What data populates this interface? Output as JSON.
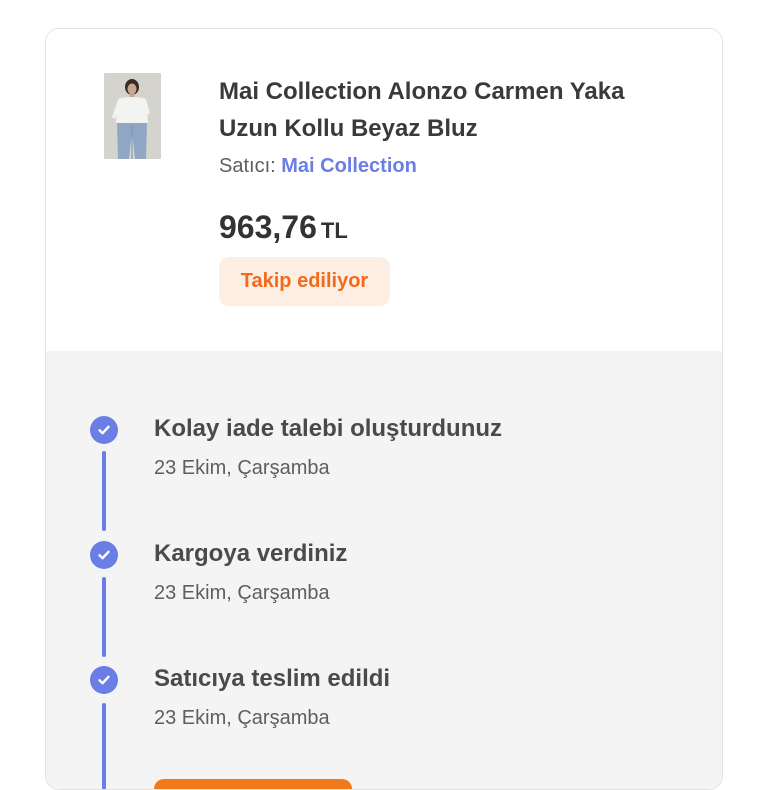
{
  "product": {
    "image_alt": "product-photo",
    "title": "Mai Collection Alonzo Carmen Yaka Uzun Kollu Beyaz Bluz",
    "seller_label": "Satıcı:",
    "seller_name": "Mai Collection",
    "price_amount": "963,76",
    "price_currency": "TL",
    "status": "Takip ediliyor"
  },
  "timeline": {
    "steps": [
      {
        "title": "Kolay iade talebi oluşturdunuz",
        "date": "23 Ekim, Çarşamba",
        "icon": "check-circle-icon"
      },
      {
        "title": "Kargoya verdiniz",
        "date": "23 Ekim, Çarşamba",
        "icon": "check-circle-icon"
      },
      {
        "title": "Satıcıya teslim edildi",
        "date": "23 Ekim, Çarşamba",
        "icon": "check-circle-icon"
      }
    ]
  },
  "colors": {
    "accent_blue": "#6a7ee6",
    "accent_orange": "#f27a1a",
    "badge_bg": "#fdeee3",
    "timeline_bg": "#f4f4f4"
  }
}
